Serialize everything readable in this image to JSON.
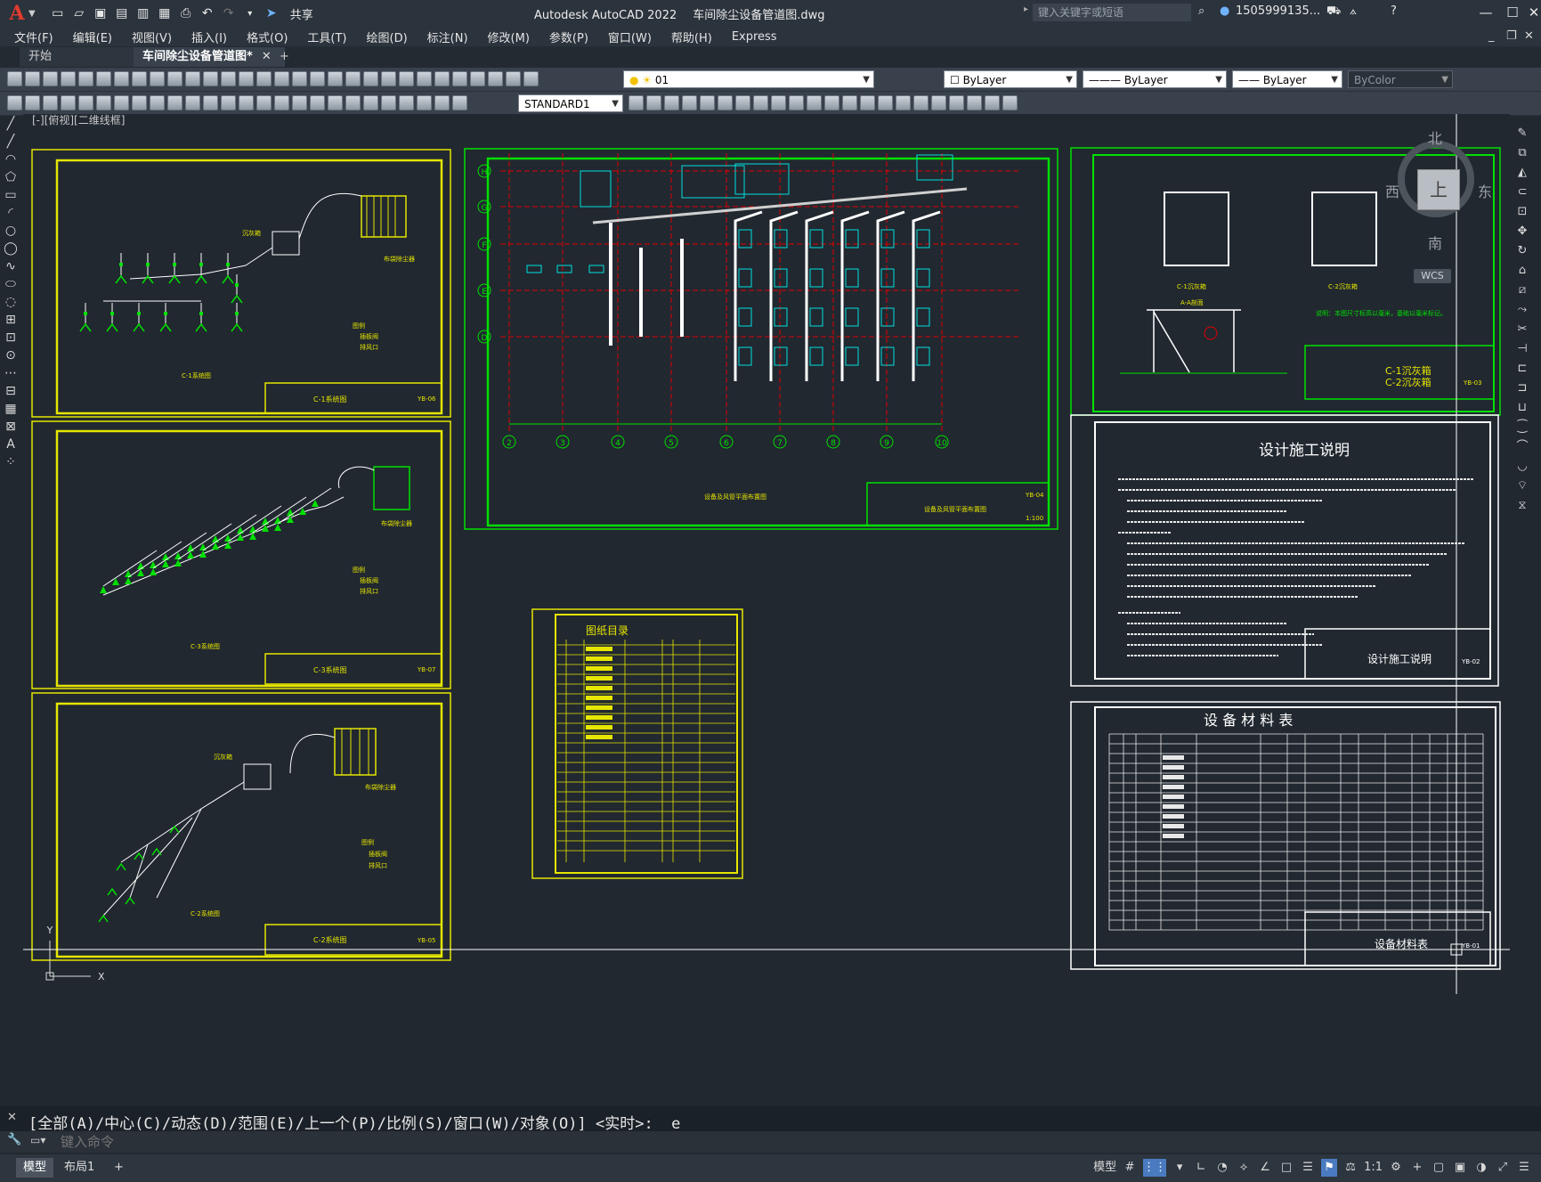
{
  "app": {
    "logo": "A",
    "title": "Autodesk AutoCAD 2022",
    "filename": "车间除尘设备管道图.dwg",
    "share_label": "共享",
    "search_placeholder": "键入关键字或短语",
    "user": "1505999135...",
    "help": "?"
  },
  "menu": [
    "文件(F)",
    "编辑(E)",
    "视图(V)",
    "插入(I)",
    "格式(O)",
    "工具(T)",
    "绘图(D)",
    "标注(N)",
    "修改(M)",
    "参数(P)",
    "窗口(W)",
    "帮助(H)",
    "Express"
  ],
  "tabs": {
    "start": "开始",
    "doc": "车间除尘设备管道图*"
  },
  "toolbar": {
    "layer": "01",
    "color": "ByLayer",
    "linetype": "ByLayer",
    "lineweight": "ByLayer",
    "plotstyle": "ByColor",
    "textstyle": "STANDARD1"
  },
  "view_label": "[-][俯视][二维线框]",
  "viewcube": {
    "north": "北",
    "south": "南",
    "east": "东",
    "west": "西",
    "top": "上",
    "wcs": "WCS"
  },
  "drawings": {
    "c1": {
      "caption": "C-1系统图",
      "title": "C-1系统图",
      "legend": "图例",
      "valve": "插板阀",
      "outlet": "排风口",
      "bag": "布袋除尘器",
      "ash": "沉灰箱",
      "code": "YB-06"
    },
    "c3": {
      "caption": "C-3系统图",
      "title": "C-3系统图",
      "legend": "图例",
      "valve": "插板阀",
      "outlet": "排风口",
      "bag": "布袋除尘器",
      "code": "YB-07"
    },
    "c2": {
      "caption": "C-2系统图",
      "title": "C-2系统图",
      "legend": "图例",
      "valve": "插板阀",
      "outlet": "排风口",
      "bag": "布袋除尘器",
      "ash": "沉灰箱",
      "code": "YB-05"
    },
    "plan": {
      "caption": "设备及风管平面布置图",
      "title": "设备及风管平面布置图",
      "code": "YB-04",
      "scale": "1:100",
      "rows": [
        "H",
        "G",
        "F",
        "E",
        "D"
      ],
      "cols": [
        "2",
        "3",
        "4",
        "5",
        "6",
        "7",
        "8",
        "9",
        "10"
      ]
    },
    "detail": {
      "title1": "C-1沉灰箱",
      "title2": "C-2沉灰箱",
      "note": "说明：本图尺寸标高以毫米，基础以毫米标记。",
      "sec": "A-A剖面",
      "code": "YB-03"
    },
    "catalog": {
      "title": "图纸目录"
    },
    "notes": {
      "title": "设计施工说明",
      "block_title": "设计施工说明",
      "code": "YB-02"
    },
    "materials": {
      "title": "设 备 材 料 表",
      "block_title": "设备材料表",
      "code": "YB-01"
    }
  },
  "command": {
    "history": "[全部(A)/中心(C)/动态(D)/范围(E)/上一个(P)/比例(S)/窗口(W)/对象(O)] <实时>: _e",
    "placeholder": "键入命令"
  },
  "status": {
    "model": "模型",
    "layout": "布局1",
    "add": "+",
    "space": "模型",
    "scale": "1:1"
  }
}
